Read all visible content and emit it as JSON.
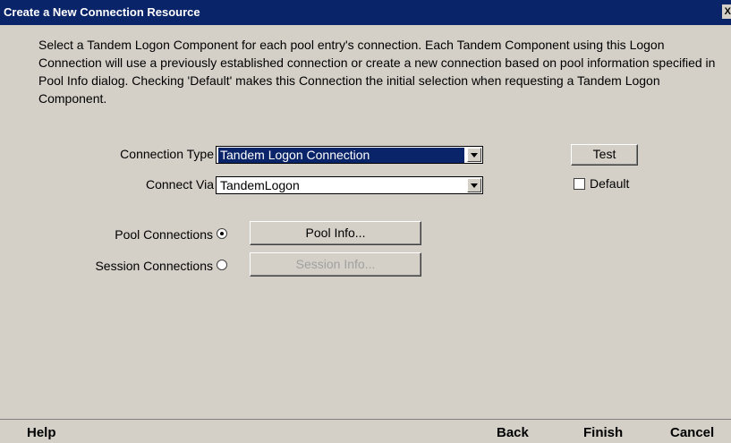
{
  "window": {
    "title": "Create a New Connection Resource",
    "close_label": "X"
  },
  "description": "Select a Tandem Logon Component for each pool entry's connection. Each Tandem Component using this Logon Connection will use a previously established connection or create a new connection based on pool information specified in Pool Info dialog. Checking 'Default' makes this Connection the initial selection when requesting a Tandem Logon Component.",
  "form": {
    "connection_type_label": "Connection Type",
    "connection_type_value": "Tandem Logon Connection",
    "connect_via_label": "Connect Via",
    "connect_via_value": "TandemLogon",
    "test_label": "Test",
    "default_label": "Default",
    "default_checked": false,
    "pool_connections_label": "Pool Connections",
    "pool_selected": true,
    "pool_info_label": "Pool Info...",
    "session_connections_label": "Session Connections",
    "session_selected": false,
    "session_info_label": "Session Info..."
  },
  "footer": {
    "help": "Help",
    "back": "Back",
    "finish": "Finish",
    "cancel": "Cancel"
  },
  "colors": {
    "titlebar": "#0a246a",
    "background": "#d4d0c8",
    "selection": "#0a246a"
  }
}
